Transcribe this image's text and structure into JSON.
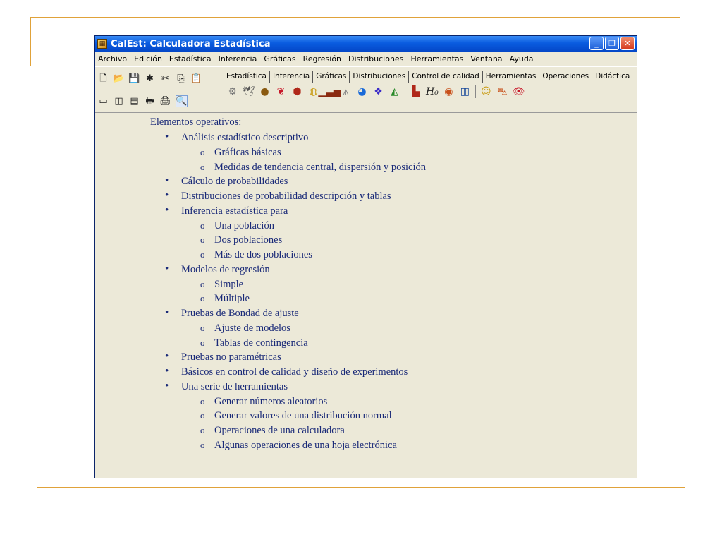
{
  "window": {
    "title": "CalEst: Calculadora Estadística",
    "buttons": [
      "_",
      "❐",
      "✕"
    ]
  },
  "menu": [
    "Archivo",
    "Edición",
    "Estadística",
    "Inferencia",
    "Gráficas",
    "Regresión",
    "Distribuciones",
    "Herramientas",
    "Ventana",
    "Ayuda"
  ],
  "tabs": {
    "items": [
      "Estadística",
      "Inferencia",
      "Gráficas",
      "Distribuciones",
      "Control de calidad",
      "Herramientas",
      "Operaciones",
      "Didáctica"
    ],
    "active": "Didáctica"
  },
  "toolbar": {
    "row1_icons": [
      "new-file-icon",
      "open-folder-icon",
      "save-icon",
      "bug-icon",
      "cut-icon",
      "copy-icon",
      "paste-icon"
    ],
    "row2_icons": [
      "window-layout-1-icon",
      "window-layout-2-icon",
      "window-layout-3-icon",
      "print-icon",
      "print-preview-icon",
      "zoom-icon"
    ],
    "palette_text": "H₀"
  },
  "content": {
    "title": "Elementos operativos:",
    "items": [
      {
        "label": "Análisis estadístico descriptivo",
        "sub": [
          "Gráficas básicas",
          "Medidas de tendencia central, dispersión y posición"
        ]
      },
      {
        "label": "Cálculo de probabilidades",
        "sub": []
      },
      {
        "label": "Distribuciones de probabilidad descripción y tablas",
        "sub": []
      },
      {
        "label": "Inferencia estadística para",
        "sub": [
          "Una población",
          "Dos poblaciones",
          "Más de dos poblaciones"
        ]
      },
      {
        "label": "Modelos de regresión",
        "sub": [
          "Simple",
          "Múltiple"
        ]
      },
      {
        "label": "Pruebas de Bondad de ajuste",
        "sub": [
          "Ajuste de modelos",
          "Tablas de contingencia"
        ]
      },
      {
        "label": "Pruebas no paramétricas",
        "sub": []
      },
      {
        "label": "Básicos en control de calidad y diseño de experimentos",
        "sub": []
      },
      {
        "label": "Una serie de herramientas",
        "sub": [
          "Generar números aleatorios",
          "Generar valores de una distribución normal",
          "Operaciones de una calculadora",
          "Algunas operaciones de una hoja electrónica"
        ]
      }
    ]
  },
  "colors": {
    "accent": "#e0a23a",
    "text": "#1a2a78",
    "window_bg": "#ece9d8",
    "titlebar": "#0a5ce0"
  }
}
